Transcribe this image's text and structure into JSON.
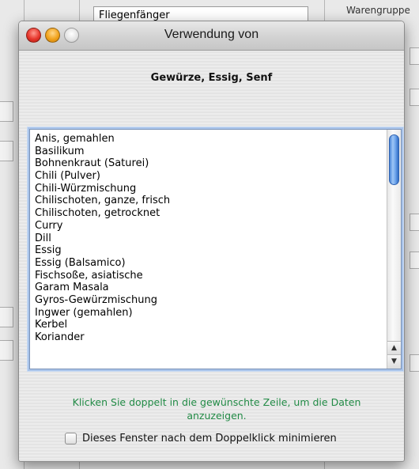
{
  "background": {
    "field_text": "Fliegenfänger",
    "right_text": "Warengruppe"
  },
  "window": {
    "title": "Verwendung von",
    "subtitle": "Gewürze, Essig, Senf"
  },
  "list": {
    "items": [
      "Anis, gemahlen",
      "Basilikum",
      "Bohnenkraut (Saturei)",
      "Chili (Pulver)",
      "Chili-Würzmischung",
      "Chilischoten, ganze, frisch",
      "Chilischoten, getrocknet",
      "Curry",
      "Dill",
      "Essig",
      "Essig (Balsamico)",
      "Fischsoße, asiatische",
      "Garam Masala",
      "Gyros-Gewürzmischung",
      "Ingwer (gemahlen)",
      "Kerbel",
      "Koriander"
    ]
  },
  "hint": "Klicken Sie doppelt in die gewünschte Zeile, um die Daten anzuzeigen.",
  "checkbox": {
    "label": "Dieses Fenster nach dem Doppelklick minimieren",
    "checked": false
  }
}
